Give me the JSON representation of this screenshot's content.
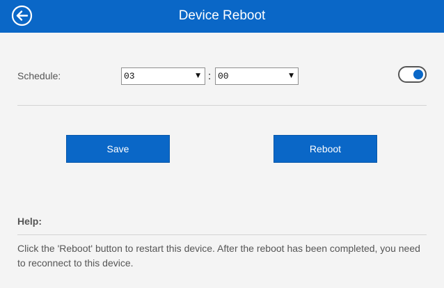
{
  "header": {
    "title": "Device Reboot",
    "back_icon": "back-arrow-circle-icon"
  },
  "schedule": {
    "label": "Schedule:",
    "hour": "03",
    "separator": ":",
    "minute": "00",
    "enabled": true
  },
  "buttons": {
    "save": "Save",
    "reboot": "Reboot"
  },
  "help": {
    "title": "Help:",
    "text": "Click the 'Reboot' button to restart this device. After the reboot has been completed, you need to reconnect to this device."
  },
  "colors": {
    "accent": "#0a67c7",
    "background": "#f4f4f4",
    "text": "#555555"
  }
}
